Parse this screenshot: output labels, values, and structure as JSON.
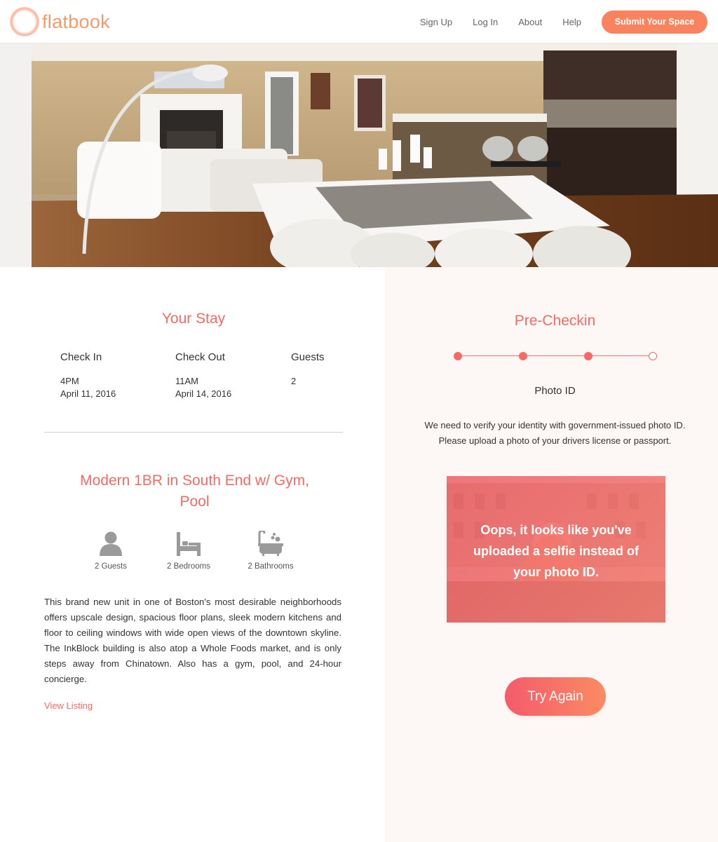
{
  "header": {
    "logo_text": "flatbook",
    "nav": [
      "Sign Up",
      "Log In",
      "About",
      "Help"
    ],
    "submit_label": "Submit Your Space"
  },
  "stay": {
    "title": "Your Stay",
    "check_in_label": "Check In",
    "check_in_time": "4PM",
    "check_in_date": "April 11, 2016",
    "check_out_label": "Check Out",
    "check_out_time": "11AM",
    "check_out_date": "April 14, 2016",
    "guests_label": "Guests",
    "guests_value": "2"
  },
  "listing": {
    "title": "Modern 1BR in South End w/ Gym, Pool",
    "amenities": [
      {
        "icon": "person-icon",
        "label": "2 Guests"
      },
      {
        "icon": "bed-icon",
        "label": "2 Bedrooms"
      },
      {
        "icon": "bathtub-icon",
        "label": "2 Bathrooms"
      }
    ],
    "description": "This brand new unit in one of Boston's most desirable neighborhoods offers upscale design, spacious floor plans, sleek modern kitchens and floor to ceiling windows with wide open views of the downtown skyline. The InkBlock building is also atop a Whole Foods market, and is only steps away from Chinatown. Also has a gym, pool, and 24-hour concierge.",
    "view_link": "View Listing"
  },
  "precheckin": {
    "title": "Pre-Checkin",
    "steps_total": 4,
    "steps_completed": 3,
    "step_label": "Photo ID",
    "step_text": "We need to verify your identity with government-issued photo ID. Please upload a photo of your drivers license or passport.",
    "error_message": "Oops, it looks like you've uploaded a selfie instead of your photo ID.",
    "retry_label": "Try Again"
  },
  "colors": {
    "accent": "#f56b63",
    "button_orange": "#f9825f",
    "right_panel_bg": "#fdf8f6"
  }
}
